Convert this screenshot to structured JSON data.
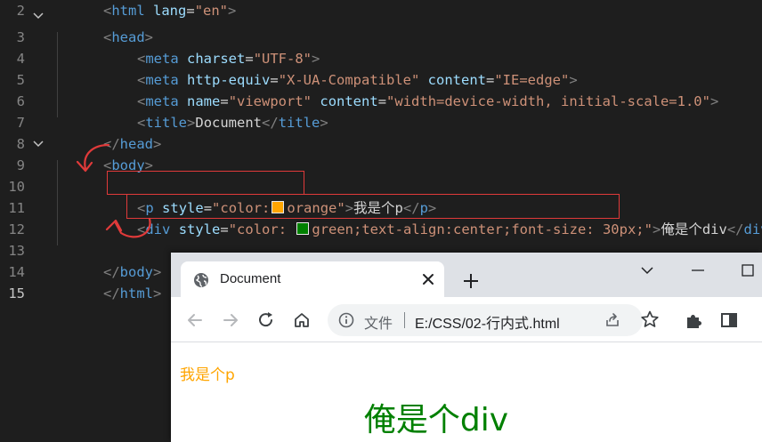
{
  "editor": {
    "line_numbers": [
      "2",
      "3",
      "4",
      "5",
      "6",
      "7",
      "8",
      "9",
      "10",
      "11",
      "12",
      "13",
      "14",
      "15"
    ],
    "line2": {
      "punc_open": "<",
      "tag": "html",
      "attr": "lang",
      "eq": "=",
      "value": "\"en\"",
      "punc_close": ">"
    },
    "line3": {
      "lt": "<",
      "tag": "head",
      "gt": ">"
    },
    "line4": {
      "lt": "<",
      "tag": "meta",
      "attr": "charset",
      "eq": "=",
      "value": "\"UTF-8\"",
      "gt": ">"
    },
    "line5": {
      "lt": "<",
      "tag": "meta",
      "attr1": "http-equiv",
      "eq1": "=",
      "value1": "\"X-UA-Compatible\"",
      "attr2": "content",
      "eq2": "=",
      "value2": "\"IE=edge\"",
      "gt": ">"
    },
    "line6": {
      "lt": "<",
      "tag": "meta",
      "attr1": "name",
      "eq1": "=",
      "value1": "\"viewport\"",
      "attr2": "content",
      "eq2": "=",
      "value2": "\"width=device-width, initial-scale=1.0\"",
      "gt": ">"
    },
    "line7": {
      "lt": "<",
      "tag": "title",
      "gt": ">",
      "text": "Document",
      "close_lt": "</",
      "close_tag": "title",
      "close_gt": ">"
    },
    "line8": {
      "lt": "</",
      "tag": "head",
      "gt": ">"
    },
    "line9": {
      "lt": "<",
      "tag": "body",
      "gt": ">"
    },
    "line11": {
      "lt": "<",
      "tag": "p",
      "attr": "style",
      "eq": "=",
      "quote_open": "\"color:",
      "value": "orange\"",
      "gt": ">",
      "text": "我是个p",
      "close_lt": "</",
      "close_tag": "p",
      "close_gt": ">"
    },
    "line12": {
      "lt": "<",
      "tag": "div",
      "attr": "style",
      "eq": "=",
      "quote_open": "\"color: ",
      "value": "green;text-align:center;font-size: 30px;\"",
      "gt": ">",
      "text": "俺是个div",
      "close_lt": "</",
      "close_tag": "div",
      "close_gt": ">"
    },
    "line14": {
      "lt": "</",
      "tag": "body",
      "gt": ">"
    },
    "line15": {
      "lt": "</",
      "tag": "html",
      "gt": ">"
    },
    "colors": {
      "orange_swatch": "#ffa500",
      "green_swatch": "#008000",
      "annotation": "#e03a3a"
    }
  },
  "browser": {
    "tab_title": "Document",
    "address_scheme": "文件",
    "address_url": "E:/CSS/02-行内式.html",
    "icons": [
      "globe-icon",
      "close-icon",
      "plus-icon",
      "chevron-down-icon",
      "minimize-icon",
      "maximize-icon",
      "back-arrow-icon",
      "forward-arrow-icon",
      "reload-icon",
      "home-icon",
      "info-icon",
      "share-icon",
      "star-icon",
      "extensions-icon",
      "sidepanel-icon"
    ],
    "page": {
      "p_text": "我是个p",
      "div_text": "俺是个div",
      "p_color": "#ffa500",
      "div_color": "#008000"
    }
  }
}
